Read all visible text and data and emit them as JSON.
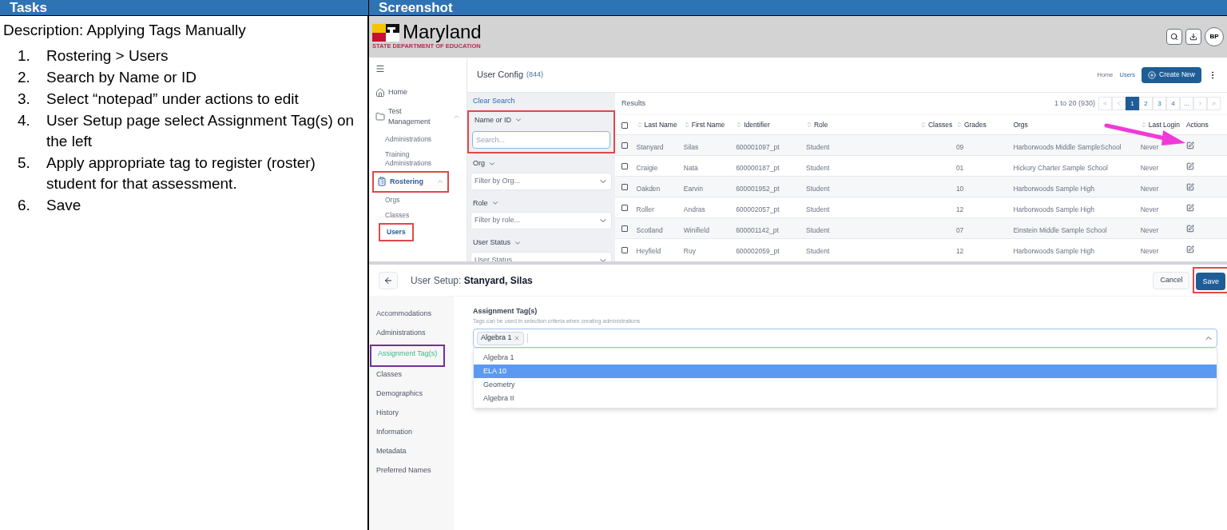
{
  "table_header": {
    "column_1": "Tasks",
    "column_2": "Screenshot"
  },
  "tasks": {
    "description": "Description: Applying Tags Manually",
    "steps": [
      {
        "number": "1.",
        "text": "Rostering > Users"
      },
      {
        "number": "2.",
        "text": "Search by Name or ID"
      },
      {
        "number": "3.",
        "text": "Select “notepad” under actions to edit"
      },
      {
        "number": "4.",
        "text": "User Setup page select Assignment Tag(s) on the left"
      },
      {
        "number": "5.",
        "text": "Apply appropriate tag to register (roster) student for that assessment."
      },
      {
        "number": "6.",
        "text": "Save"
      }
    ]
  },
  "screenshot": {
    "logo": {
      "name": "Maryland",
      "subtitle": "STATE DEPARTMENT OF EDUCATION"
    },
    "avatar": "BP",
    "sidebar": {
      "items": [
        {
          "label": "Home",
          "kind": "home",
          "selected": false,
          "highlighted": false
        },
        {
          "label": "Test Management",
          "kind": "folder",
          "selected": false,
          "highlighted": false,
          "expanded": true,
          "children": [
            {
              "label": "Administrations",
              "selected": false,
              "highlighted": false
            },
            {
              "label": "Training Administrations",
              "selected": false,
              "highlighted": false
            }
          ]
        },
        {
          "label": "Rostering",
          "kind": "clipboard",
          "selected": true,
          "highlighted": true,
          "expanded": true,
          "children": [
            {
              "label": "Orgs",
              "selected": false,
              "highlighted": false
            },
            {
              "label": "Classes",
              "selected": false,
              "highlighted": false
            },
            {
              "label": "Users",
              "selected": true,
              "highlighted": true
            }
          ]
        }
      ]
    },
    "page_header": {
      "title": "User Config",
      "count": "(844)",
      "breadcrumb": [
        "Home",
        "Users"
      ],
      "create_button": "Create New"
    },
    "filters": {
      "clear_search": "Clear Search",
      "fields": [
        {
          "label": "Name or ID",
          "placeholder": "Search...",
          "kind": "text",
          "highlighted": true
        },
        {
          "label": "Org",
          "placeholder": "Filter by Org...",
          "kind": "select",
          "highlighted": false
        },
        {
          "label": "Role",
          "placeholder": "Filter by role...",
          "kind": "select",
          "highlighted": false
        },
        {
          "label": "User Status",
          "placeholder": "User Status",
          "kind": "select",
          "highlighted": false
        }
      ]
    },
    "results": {
      "title": "Results",
      "select_all_checked": false,
      "range": "1 to 20 (930)",
      "pages": [
        {
          "label": "1",
          "selected": true
        },
        {
          "label": "2",
          "selected": false
        },
        {
          "label": "3",
          "selected": false
        },
        {
          "label": "4",
          "selected": false
        },
        {
          "label": "...",
          "selected": false
        }
      ],
      "columns": [
        {
          "label": "Last Name",
          "sortable": true
        },
        {
          "label": "First Name",
          "sortable": true
        },
        {
          "label": "Identifier",
          "sortable": true
        },
        {
          "label": "Role",
          "sortable": true
        },
        {
          "label": "Classes",
          "sortable": true
        },
        {
          "label": "Grades",
          "sortable": true
        },
        {
          "label": "Orgs",
          "sortable": false
        },
        {
          "label": "Last Login",
          "sortable": true
        },
        {
          "label": "Actions",
          "sortable": false
        }
      ],
      "rows": [
        {
          "checked": false,
          "cells": [
            "Stanyard",
            "Silas",
            "600001097_pt",
            "Student",
            "",
            "09",
            "Harborwoods Middle SampleSchool",
            "Never"
          ]
        },
        {
          "checked": false,
          "cells": [
            "Craigie",
            "Nata",
            "600000187_pt",
            "Student",
            "",
            "01",
            "Hickory Charter Sample School",
            "Never"
          ]
        },
        {
          "checked": false,
          "cells": [
            "Oakden",
            "Earvin",
            "600001952_pt",
            "Student",
            "",
            "10",
            "Harborwoods Sample High",
            "Never"
          ]
        },
        {
          "checked": false,
          "cells": [
            "Roller",
            "Andras",
            "600002057_pt",
            "Student",
            "",
            "12",
            "Harborwoods Sample High",
            "Never"
          ]
        },
        {
          "checked": false,
          "cells": [
            "Scotland",
            "Winifield",
            "600001142_pt",
            "Student",
            "",
            "07",
            "Einstein Middle Sample School",
            "Never"
          ]
        },
        {
          "checked": false,
          "cells": [
            "Heyfield",
            "Ruy",
            "600002059_pt",
            "Student",
            "",
            "12",
            "Harborwoods Sample High",
            "Never"
          ]
        }
      ]
    },
    "user_setup": {
      "title": "User Setup:",
      "name": "Stanyard, Silas",
      "cancel": "Cancel",
      "save": {
        "label": "Save",
        "highlighted": true
      },
      "nav": [
        {
          "label": "Accommodations",
          "selected": false,
          "highlighted": false
        },
        {
          "label": "Administrations",
          "selected": false,
          "highlighted": false
        },
        {
          "label": "Assignment Tag(s)",
          "selected": true,
          "highlighted": true
        },
        {
          "label": "Classes",
          "selected": false,
          "highlighted": false
        },
        {
          "label": "Demographics",
          "selected": false,
          "highlighted": false
        },
        {
          "label": "History",
          "selected": false,
          "highlighted": false
        },
        {
          "label": "Information",
          "selected": false,
          "highlighted": false
        },
        {
          "label": "Metadata",
          "selected": false,
          "highlighted": false
        },
        {
          "label": "Preferred Names",
          "selected": false,
          "highlighted": false
        }
      ],
      "tags": {
        "label": "Assignment Tag(s)",
        "hint": "Tags can be used in selection criteria when creating administrations",
        "chosen": [
          "Algebra 1"
        ],
        "expanded": true,
        "options": [
          {
            "label": "Algebra 1",
            "selected": false
          },
          {
            "label": "ELA 10",
            "selected": true
          },
          {
            "label": "Geometry",
            "selected": false
          },
          {
            "label": "Algebra II",
            "selected": false
          }
        ]
      }
    }
  }
}
